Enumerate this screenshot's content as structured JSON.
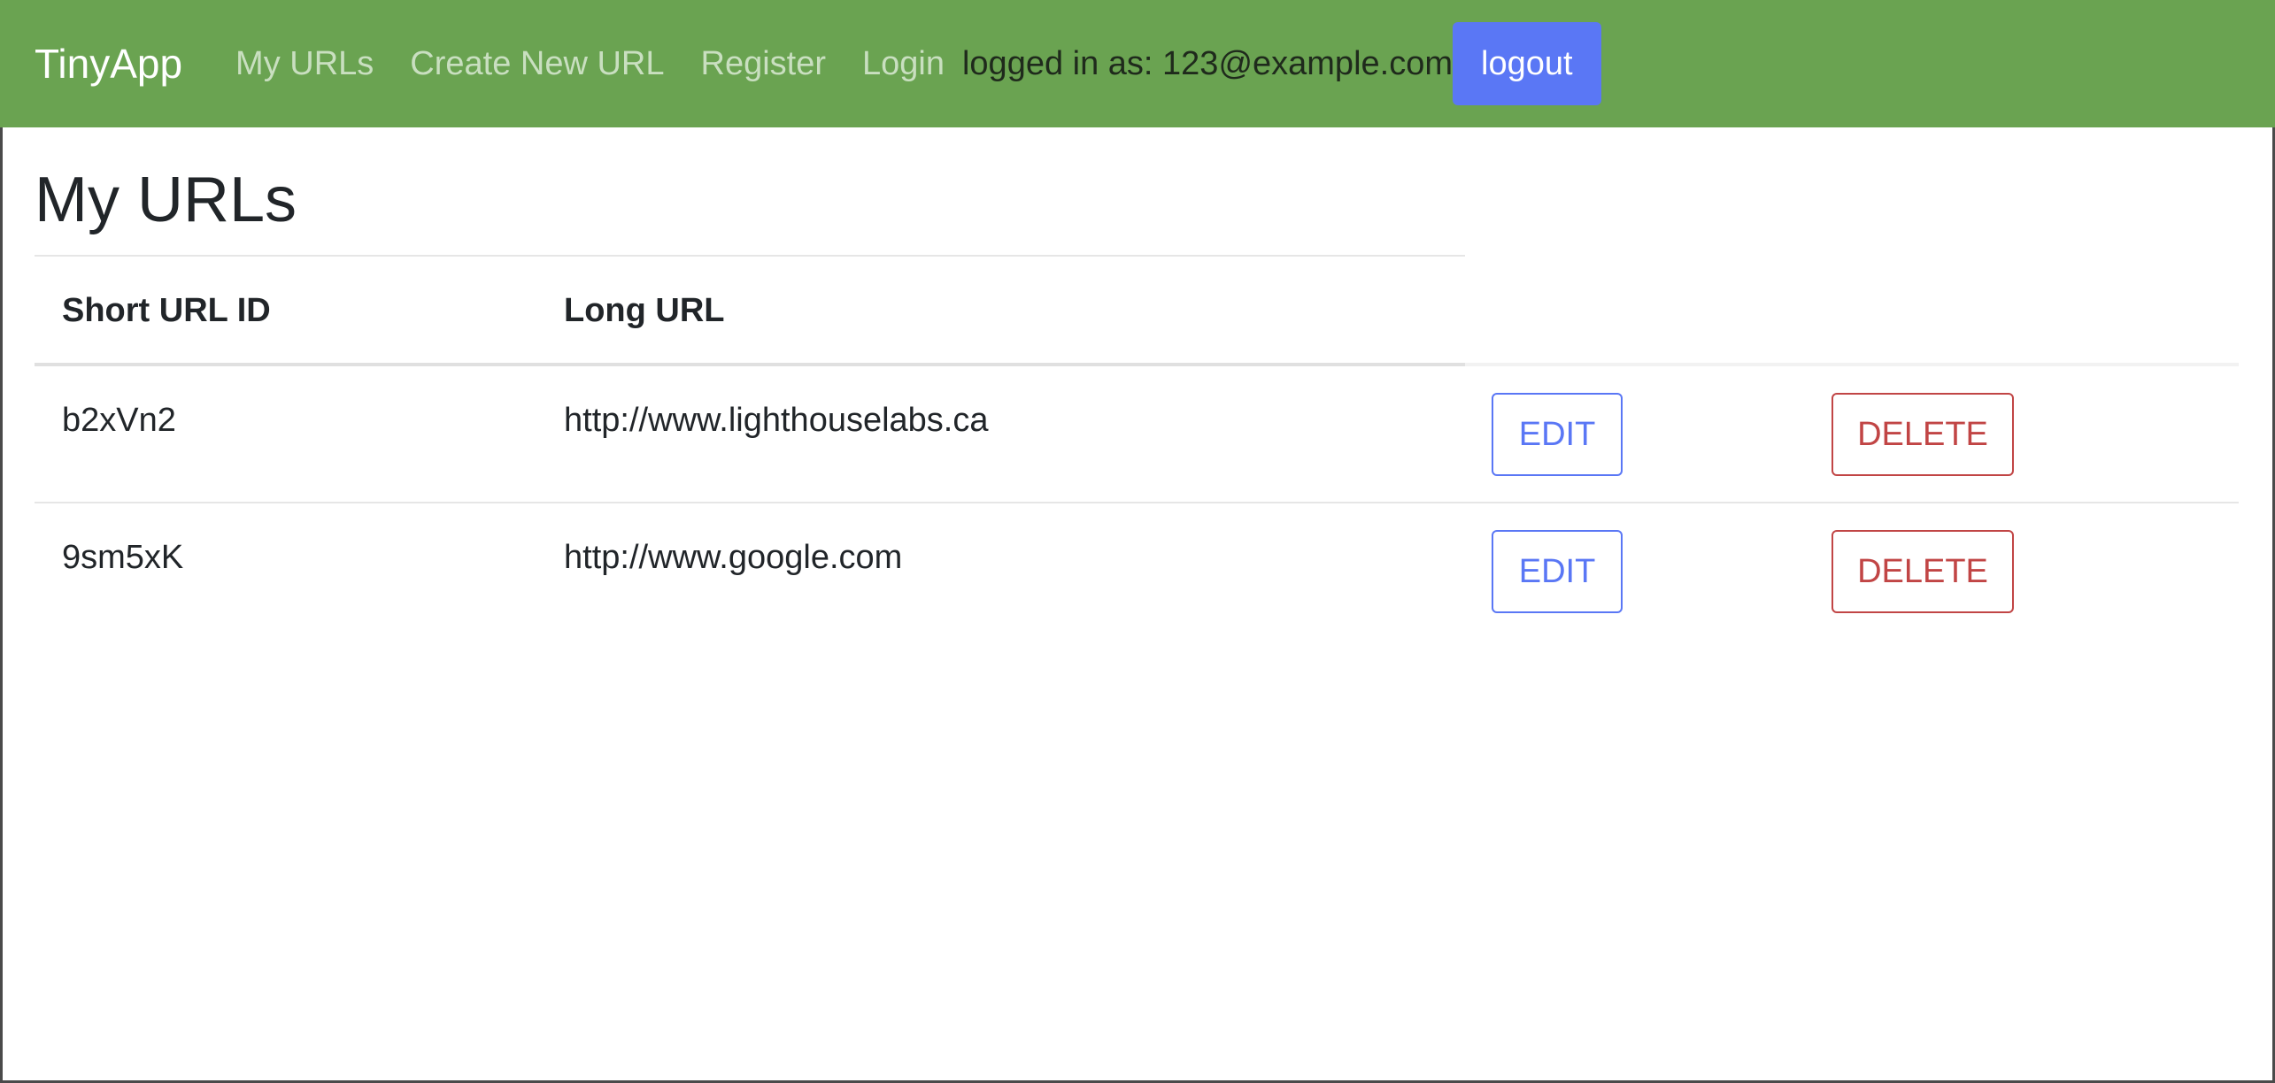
{
  "navbar": {
    "brand": "TinyApp",
    "links": [
      "My URLs",
      "Create New URL",
      "Register",
      "Login"
    ],
    "login_status": "logged in as: 123@example.com",
    "logout_label": "logout"
  },
  "main": {
    "title": "My URLs",
    "table": {
      "headers": [
        "Short URL ID",
        "Long URL"
      ],
      "rows": [
        {
          "short_id": "b2xVn2",
          "long_url": "http://www.lighthouselabs.ca",
          "edit_label": "EDIT",
          "delete_label": "DELETE"
        },
        {
          "short_id": "9sm5xK",
          "long_url": "http://www.google.com",
          "edit_label": "EDIT",
          "delete_label": "DELETE"
        }
      ]
    }
  },
  "colors": {
    "navbar_bg": "#6aa351",
    "primary": "#5a77f5",
    "danger": "#c14545"
  }
}
